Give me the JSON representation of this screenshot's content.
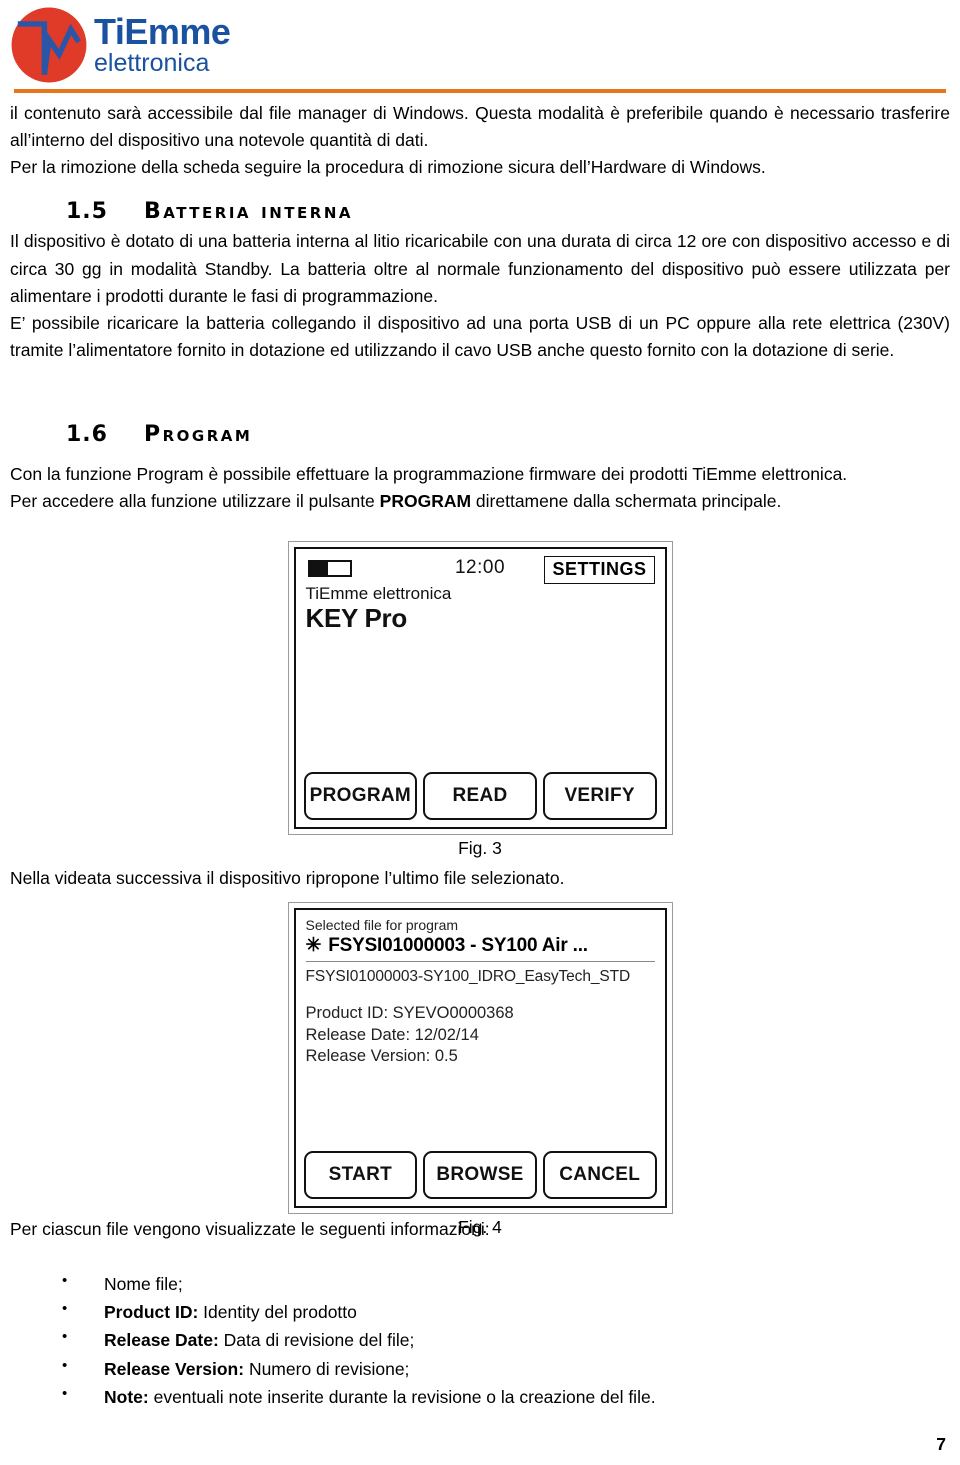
{
  "header": {
    "logo_primary": "TiEmme",
    "logo_secondary": "elettronica",
    "logo_circle_color": "#e03a28",
    "logo_text_color": "#1a52a0",
    "rule_color": "#e8751a"
  },
  "intro": {
    "para1": "il contenuto sarà accessibile dal file manager di Windows. Questa modalità è preferibile quando è necessario trasferire all’interno del dispositivo una notevole quantità di dati.",
    "para2": "Per la rimozione della scheda seguire la procedura di rimozione sicura dell’Hardware di Windows."
  },
  "section_battery": {
    "number": "1.5",
    "title": "Batteria interna",
    "para1": "Il dispositivo è dotato di una batteria interna al litio ricaricabile con una durata di circa 12 ore con dispositivo accesso e di circa 30 gg in modalità Standby. La batteria oltre al normale funzionamento del dispositivo può essere utilizzata per alimentare i prodotti durante le fasi di programmazione.",
    "para2": "E’ possibile ricaricare la batteria collegando il dispositivo ad una porta USB di un PC oppure alla rete elettrica (230V) tramite l’alimentatore fornito in dotazione ed utilizzando il cavo USB anche questo fornito con la dotazione di serie."
  },
  "section_program": {
    "number": "1.6",
    "title": "Program",
    "para1": "Con la funzione Program è possibile effettuare la programmazione firmware dei prodotti TiEmme elettronica.",
    "para2_before": "Per accedere alla funzione utilizzare il pulsante ",
    "para2_bold": "PROGRAM",
    "para2_after": " direttamene dalla schermata principale."
  },
  "figure3": {
    "caption": "Fig. 3",
    "battery_icon": "battery-icon",
    "clock": "12:00",
    "settings_button": "SETTINGS",
    "brand": "TiEmme elettronica",
    "model": "KEY Pro",
    "buttons": [
      "PROGRAM",
      "READ",
      "VERIFY"
    ]
  },
  "between_figures": {
    "text": "Nella videata successiva il dispositivo ripropone l’ultimo file selezionato."
  },
  "figure4": {
    "caption": "Fig. 4",
    "selected_label": "Selected file for program",
    "star_icon": "✳",
    "selected_file": "FSYSI01000003 - SY100 Air ...",
    "full_file_name": "FSYSI01000003-SY100_IDRO_EasyTech_STD",
    "product_id": "Product ID: SYEVO0000368",
    "release_date": "Release Date: 12/02/14",
    "release_version": "Release Version: 0.5",
    "buttons": [
      "START",
      "BROWSE",
      "CANCEL"
    ]
  },
  "list_section": {
    "intro": "Per ciascun file vengono visualizzate le seguenti informazioni:",
    "items": [
      {
        "bold": "",
        "text": "Nome file;"
      },
      {
        "bold": "Product ID:",
        "text": " Identity del prodotto"
      },
      {
        "bold": "Release Date:",
        "text": " Data di revisione del file;"
      },
      {
        "bold": "Release Version:",
        "text": " Numero di revisione;"
      },
      {
        "bold": "Note:",
        "text": " eventuali note inserite durante la revisione o la creazione del file."
      }
    ]
  },
  "footer": {
    "page_number": "7"
  }
}
